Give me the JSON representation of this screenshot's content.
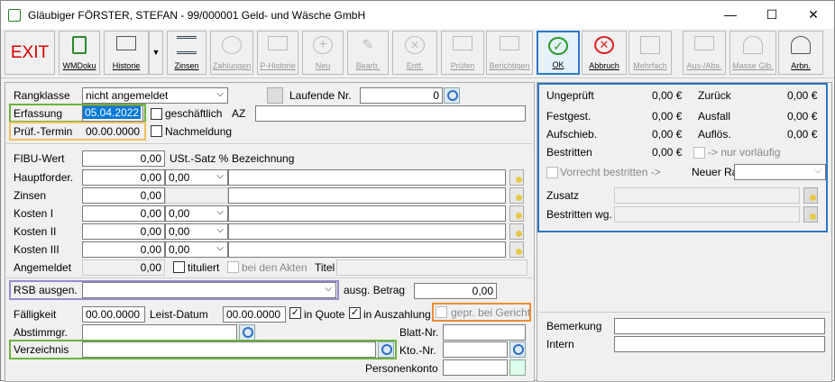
{
  "window": {
    "title": "Gläubiger FÖRSTER, STEFAN - 99/000001 Geld- und Wäsche GmbH",
    "minimize": "—",
    "maximize": "☐",
    "close": "✕"
  },
  "toolbar": {
    "exit": "EXIT",
    "wmdoku": "WMDoku",
    "historie": "Historie",
    "zinsen": "Zinsen",
    "zahlungen": "Zahlungen",
    "phistorie": "P-Historie",
    "neu": "Neu",
    "bearb": "Bearb.",
    "entf": "Entf.",
    "pruefen": "Prüfen",
    "berichtigen": "Berichtigen",
    "ok": "OK",
    "abbruch": "Abbruch",
    "mehrfach": "Mehrfach",
    "ausabs": "Aus-/Abs.",
    "masseglb": "Masse Glb.",
    "arbn": "Arbn."
  },
  "form": {
    "rangklasse_label": "Rangklasse",
    "rangklasse_value": "nicht angemeldet",
    "laufende_nr_label": "Laufende Nr.",
    "laufende_nr_value": "0",
    "erfassung_label": "Erfassung",
    "erfassung_value": "05.04.2022",
    "geschaeftlich": "geschäftlich",
    "az_label": "AZ",
    "az_value": "",
    "pruef_label": "Prüf.-Termin",
    "pruef_value": "00.00.0000",
    "nachmeldung": "Nachmeldung",
    "fibu_label": "FIBU-Wert",
    "fibu_value": "0,00",
    "ust_label": "USt.-Satz %",
    "bez_label": "Bezeichnung",
    "rows": [
      {
        "label": "Hauptforder.",
        "value": "0,00",
        "ust": "0,00"
      },
      {
        "label": "Zinsen",
        "value": "0,00",
        "ust": ""
      },
      {
        "label": "Kosten I",
        "value": "0,00",
        "ust": "0,00"
      },
      {
        "label": "Kosten II",
        "value": "0,00",
        "ust": "0,00"
      },
      {
        "label": "Kosten III",
        "value": "0,00",
        "ust": "0,00"
      }
    ],
    "angemeldet_label": "Angemeldet",
    "angemeldet_value": "0,00",
    "tituliert": "tituliert",
    "bei_akten": "bei den Akten",
    "titel_label": "Titel",
    "rsb_label": "RSB ausgen.",
    "ausg_betrag_label": "ausg. Betrag",
    "ausg_betrag_value": "0,00",
    "faelligkeit_label": "Fälligkeit",
    "faelligkeit_value": "00.00.0000",
    "leist_label": "Leist-Datum",
    "leist_value": "00.00.0000",
    "in_quote": "in Quote",
    "in_auszahlung": "in Auszahlung",
    "gepr_gericht": "gepr. bei Gericht",
    "abstimm_label": "Abstimmgr.",
    "blatt_label": "Blatt-Nr.",
    "verz_label": "Verzeichnis",
    "kto_label": "Kto.-Nr.",
    "personen_label": "Personenkonto"
  },
  "summary": {
    "ungeprueft": "Ungeprüft",
    "ungeprueft_v": "0,00 €",
    "zurueck": "Zurück",
    "zurueck_v": "0,00 €",
    "festgest": "Festgest.",
    "festgest_v": "0,00 €",
    "ausfall": "Ausfall",
    "ausfall_v": "0,00 €",
    "aufschieb": "Aufschieb.",
    "aufschieb_v": "0,00 €",
    "aufloes": "Auflös.",
    "aufloes_v": "0,00 €",
    "bestritten": "Bestritten",
    "bestritten_v": "0,00 €",
    "nur_vorl": "-> nur vorläufig",
    "vorrecht": "Vorrecht bestritten ->",
    "neuer_rang": "Neuer Rang",
    "zusatz": "Zusatz",
    "bestritten_wg": "Bestritten wg."
  },
  "notes": {
    "bemerkung": "Bemerkung",
    "intern": "Intern"
  }
}
